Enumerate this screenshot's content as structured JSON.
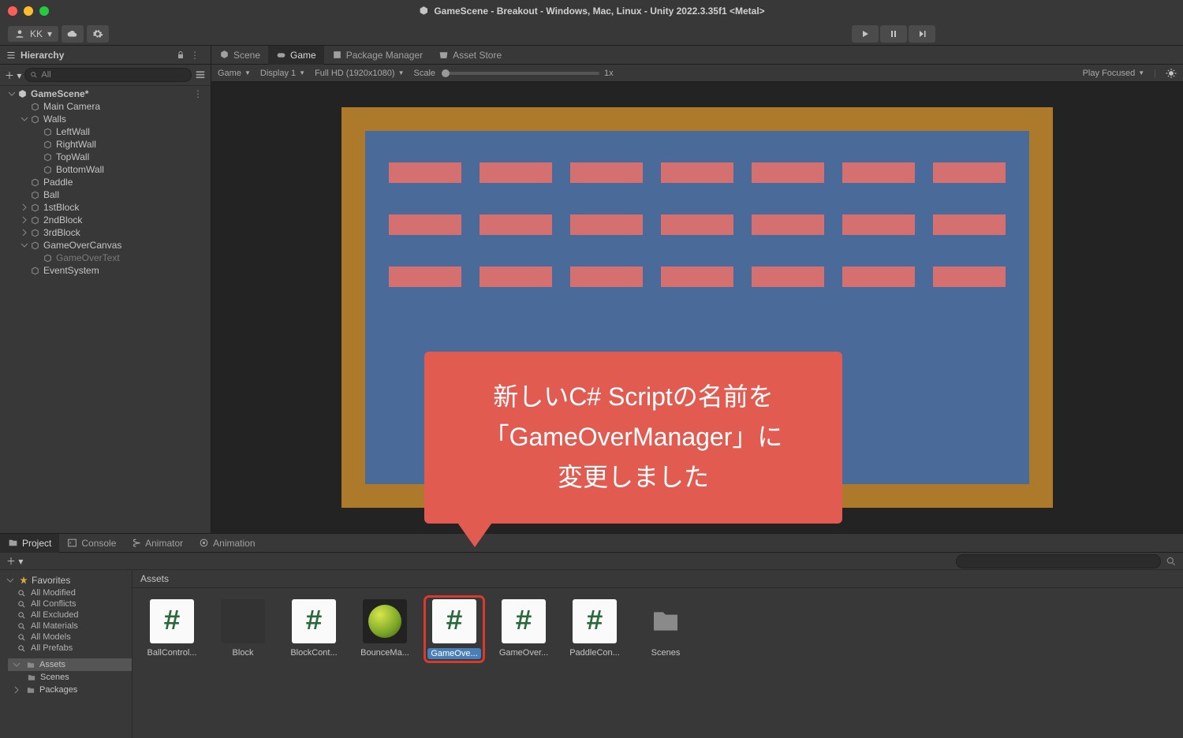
{
  "window": {
    "title": "GameScene - Breakout - Windows, Mac, Linux - Unity 2022.3.35f1 <Metal>"
  },
  "user": {
    "initials": "KK",
    "dropdown": "▾"
  },
  "hierarchy": {
    "title": "Hierarchy",
    "search_label": "All",
    "scene": "GameScene*",
    "items": [
      {
        "name": "Main Camera",
        "depth": 1
      },
      {
        "name": "Walls",
        "depth": 1,
        "open": true
      },
      {
        "name": "LeftWall",
        "depth": 2
      },
      {
        "name": "RightWall",
        "depth": 2
      },
      {
        "name": "TopWall",
        "depth": 2
      },
      {
        "name": "BottomWall",
        "depth": 2
      },
      {
        "name": "Paddle",
        "depth": 1
      },
      {
        "name": "Ball",
        "depth": 1
      },
      {
        "name": "1stBlock",
        "depth": 1,
        "prefab": true
      },
      {
        "name": "2ndBlock",
        "depth": 1,
        "prefab": true
      },
      {
        "name": "3rdBlock",
        "depth": 1,
        "prefab": true
      },
      {
        "name": "GameOverCanvas",
        "depth": 1,
        "open": true
      },
      {
        "name": "GameOverText",
        "depth": 2,
        "dim": true
      },
      {
        "name": "EventSystem",
        "depth": 1
      }
    ]
  },
  "game": {
    "tabs": [
      "Scene",
      "Game",
      "Package Manager",
      "Asset Store"
    ],
    "toolbar": {
      "mode": "Game",
      "display": "Display 1",
      "res": "Full HD (1920x1080)",
      "scale_label": "Scale",
      "scale": "1x",
      "play_focused": "Play Focused"
    }
  },
  "callout": {
    "line1": "新しいC# Scriptの名前を",
    "line2": "「GameOverManager」に",
    "line3": "変更しました"
  },
  "bottom": {
    "tabs": [
      "Project",
      "Console",
      "Animator",
      "Animation"
    ],
    "favorites": {
      "header": "Favorites",
      "items": [
        "All Modified",
        "All Conflicts",
        "All Excluded",
        "All Materials",
        "All Models",
        "All Prefabs"
      ]
    },
    "tree": {
      "assets": "Assets",
      "scenes": "Scenes",
      "packages": "Packages"
    },
    "crumb": "Assets",
    "assets": [
      {
        "label": "BallControl...",
        "type": "script"
      },
      {
        "label": "Block",
        "type": "block"
      },
      {
        "label": "BlockCont...",
        "type": "script"
      },
      {
        "label": "BounceMa...",
        "type": "material"
      },
      {
        "label": "GameOve...",
        "type": "script",
        "selected": true
      },
      {
        "label": "GameOver...",
        "type": "script"
      },
      {
        "label": "PaddleCon...",
        "type": "script"
      },
      {
        "label": "Scenes",
        "type": "folder"
      }
    ]
  }
}
